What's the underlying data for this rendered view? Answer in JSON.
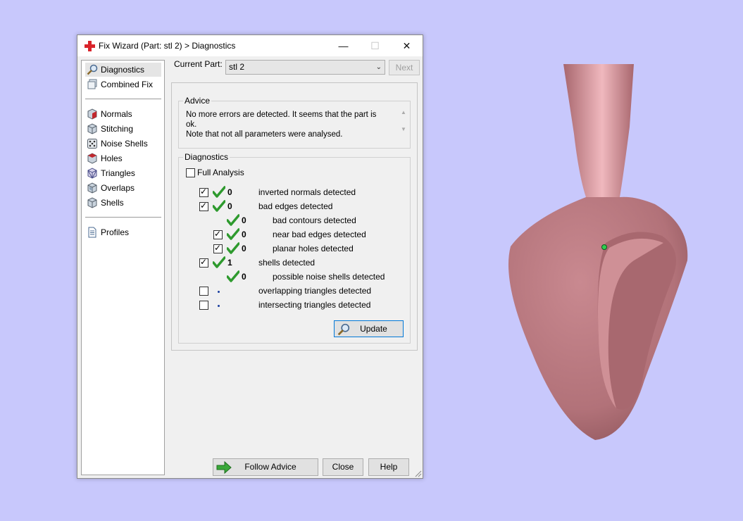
{
  "window": {
    "title": "Fix Wizard (Part: stl 2) > Diagnostics",
    "minimize_label": "—",
    "maximize_label": "☐",
    "close_label": "✕"
  },
  "sidebar": {
    "top_items": [
      {
        "label": "Diagnostics",
        "icon": "magnifier-icon",
        "selected": true
      },
      {
        "label": "Combined Fix",
        "icon": "combined-fix-icon",
        "selected": false
      }
    ],
    "fix_items": [
      {
        "label": "Normals",
        "icon": "normals-cube-icon"
      },
      {
        "label": "Stitching",
        "icon": "stitching-cube-icon"
      },
      {
        "label": "Noise Shells",
        "icon": "noise-shells-dice-icon"
      },
      {
        "label": "Holes",
        "icon": "holes-cube-icon"
      },
      {
        "label": "Triangles",
        "icon": "triangles-cube-icon"
      },
      {
        "label": "Overlaps",
        "icon": "overlaps-cube-icon"
      },
      {
        "label": "Shells",
        "icon": "shells-cube-icon"
      }
    ],
    "bottom_items": [
      {
        "label": "Profiles",
        "icon": "profiles-document-icon"
      }
    ]
  },
  "header": {
    "current_part_label": "Current Part:",
    "current_part_value": "stl 2",
    "next_label": "Next"
  },
  "advice": {
    "title": "Advice",
    "text_line1": "No more errors are detected. It seems that the part is ok.",
    "text_line2": "Note that not all parameters were analysed."
  },
  "diagnostics": {
    "title": "Diagnostics",
    "full_analysis_label": "Full Analysis",
    "full_analysis_checked": false,
    "rows": [
      {
        "checkbox": true,
        "checked": true,
        "status": "ok",
        "count": "0",
        "label": "inverted normals detected",
        "indent": 0
      },
      {
        "checkbox": true,
        "checked": true,
        "status": "ok",
        "count": "0",
        "label": "bad edges detected",
        "indent": 0
      },
      {
        "checkbox": false,
        "checked": false,
        "status": "ok",
        "count": "0",
        "label": "bad contours detected",
        "indent": 1
      },
      {
        "checkbox": true,
        "checked": true,
        "status": "ok",
        "count": "0",
        "label": "near bad edges detected",
        "indent": 1
      },
      {
        "checkbox": true,
        "checked": true,
        "status": "ok",
        "count": "0",
        "label": "planar holes detected",
        "indent": 1
      },
      {
        "checkbox": true,
        "checked": true,
        "status": "ok",
        "count": "1",
        "label": "shells detected",
        "indent": 0
      },
      {
        "checkbox": false,
        "checked": false,
        "status": "ok",
        "count": "0",
        "label": "possible noise shells detected",
        "indent": 1
      },
      {
        "checkbox": true,
        "checked": false,
        "status": "pending",
        "count": "",
        "label": "overlapping triangles detected",
        "indent": 0
      },
      {
        "checkbox": true,
        "checked": false,
        "status": "pending",
        "count": "",
        "label": "intersecting triangles detected",
        "indent": 0
      }
    ],
    "update_label": "Update"
  },
  "footer": {
    "follow_advice_label": "Follow Advice",
    "close_label": "Close",
    "help_label": "Help"
  },
  "colors": {
    "background": "#c8c8fc",
    "model": "#b97a80",
    "check_green": "#2e9a2e",
    "accent_blue": "#0078d7"
  }
}
